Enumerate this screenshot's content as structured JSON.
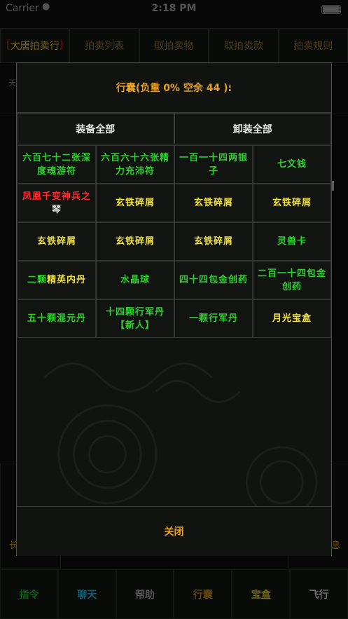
{
  "status_bar": {
    "carrier": "Carrier",
    "time": "2:18 PM"
  },
  "tabs": [
    {
      "label": "大唐拍卖行",
      "active": true
    },
    {
      "label": "拍卖列表",
      "active": false
    },
    {
      "label": "取拍卖物",
      "active": false
    },
    {
      "label": "取拍卖款",
      "active": false
    },
    {
      "label": "拍卖规则",
      "active": false
    }
  ],
  "background": {
    "row_text": "天",
    "left_label": "长",
    "right_label": "息"
  },
  "modal": {
    "title": "行囊(负重 0% 空余 44 ):",
    "equip_all_label": "装备全部",
    "unequip_all_label": "卸装全部",
    "items": [
      {
        "text": "六百七十二张深度魂游符",
        "color": "green"
      },
      {
        "text": "六百六十六张精力充沛符",
        "color": "green"
      },
      {
        "text": "一百一十四两银子",
        "color": "green"
      },
      {
        "text": "七文钱",
        "color": "green"
      },
      {
        "text_main": "凤凰千变神兵之",
        "text_suffix": "琴",
        "color": "red"
      },
      {
        "text": "玄铁碎屑",
        "color": "yellow"
      },
      {
        "text": "玄铁碎屑",
        "color": "yellow"
      },
      {
        "text": "玄铁碎屑",
        "color": "yellow"
      },
      {
        "text": "玄铁碎屑",
        "color": "yellow"
      },
      {
        "text": "玄铁碎屑",
        "color": "yellow"
      },
      {
        "text": "玄铁碎屑",
        "color": "yellow"
      },
      {
        "text": "灵兽卡",
        "color": "yellow"
      },
      {
        "text_prefix": "二颗",
        "text_main": "精英内丹",
        "color": "yellow"
      },
      {
        "text": "水晶球",
        "color": "green"
      },
      {
        "text": "四十四包金创药",
        "color": "green"
      },
      {
        "text": "二百一十四包金创药",
        "color": "green"
      },
      {
        "text": "五十颗混元丹",
        "color": "green"
      },
      {
        "text": "十四颗行军丹【新人】",
        "color": "green"
      },
      {
        "text": "一颗行军丹",
        "color": "green"
      },
      {
        "text": "月光宝盒",
        "color": "yellow"
      }
    ],
    "close_label": "关闭"
  },
  "bottom_nav": [
    {
      "label": "指令",
      "color": "#1fa82a"
    },
    {
      "label": "聊天",
      "color": "#2aa6c8"
    },
    {
      "label": "帮助",
      "color": "#9a9a9a"
    },
    {
      "label": "行囊",
      "color": "#b37a1a"
    },
    {
      "label": "宝盒",
      "color": "#d4c21a"
    },
    {
      "label": "飞行",
      "color": "#c8c8c8"
    }
  ]
}
